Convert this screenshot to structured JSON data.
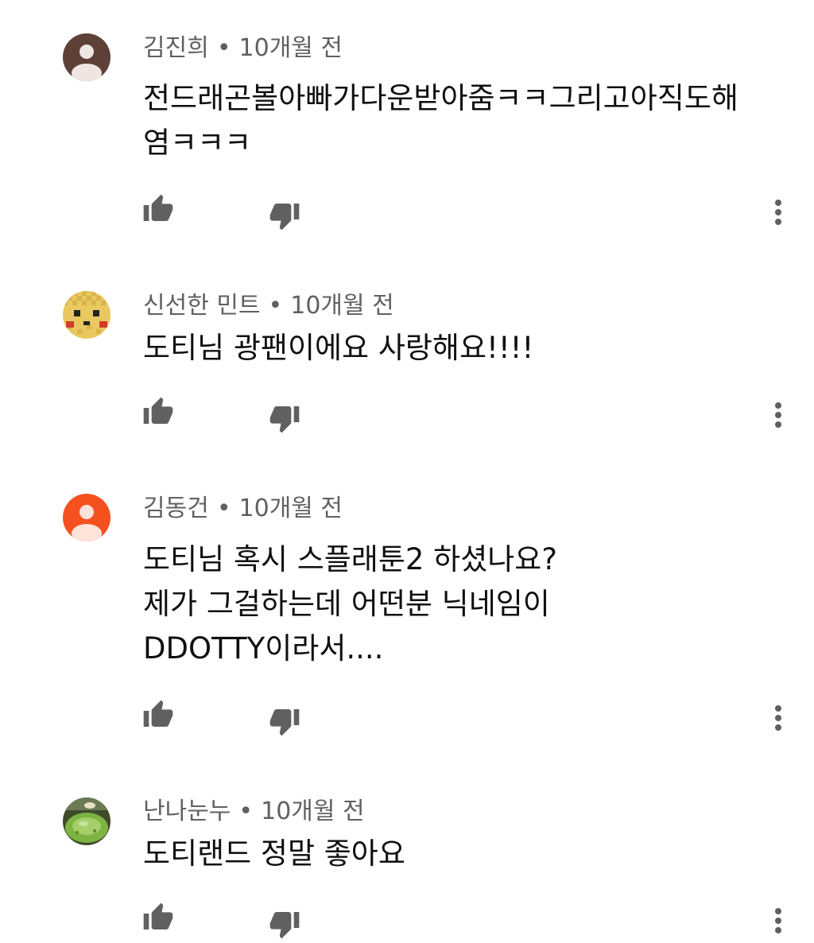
{
  "comments": [
    {
      "author": "김진희",
      "separator": "•",
      "time": "10개월 전",
      "text": "전드래곤볼아빠가다운받아줌ㅋㅋ그리고아직도해\n염ㅋㅋㅋ",
      "avatar_icon": "person-icon",
      "avatar_color": "#5d4037"
    },
    {
      "author": "신선한 민트",
      "separator": "•",
      "time": "10개월 전",
      "text": "도티님 광팬이에요 사랑해요!!!!",
      "avatar_icon": "pixel-pikachu-avatar",
      "avatar_color": "#e8c860"
    },
    {
      "author": "김동건",
      "separator": "•",
      "time": "10개월 전",
      "text": "도티님 혹시 스플래툰2 하셨나요?\n제가 그걸하는데 어떤분 닉네임이\nDDOTTY이라서....",
      "avatar_icon": "person-icon",
      "avatar_color": "#f4511e"
    },
    {
      "author": "난나눈누",
      "separator": "•",
      "time": "10개월 전",
      "text": "도티랜드 정말 좋아요",
      "avatar_icon": "food-photo-avatar",
      "avatar_color": "#7cb342"
    }
  ],
  "icons": {
    "like": "thumbs-up-icon",
    "dislike": "thumbs-down-icon",
    "more": "more-vert-icon"
  },
  "colors": {
    "icon": "#606060",
    "meta_text": "#606060",
    "body_text": "#0f0f0f"
  }
}
